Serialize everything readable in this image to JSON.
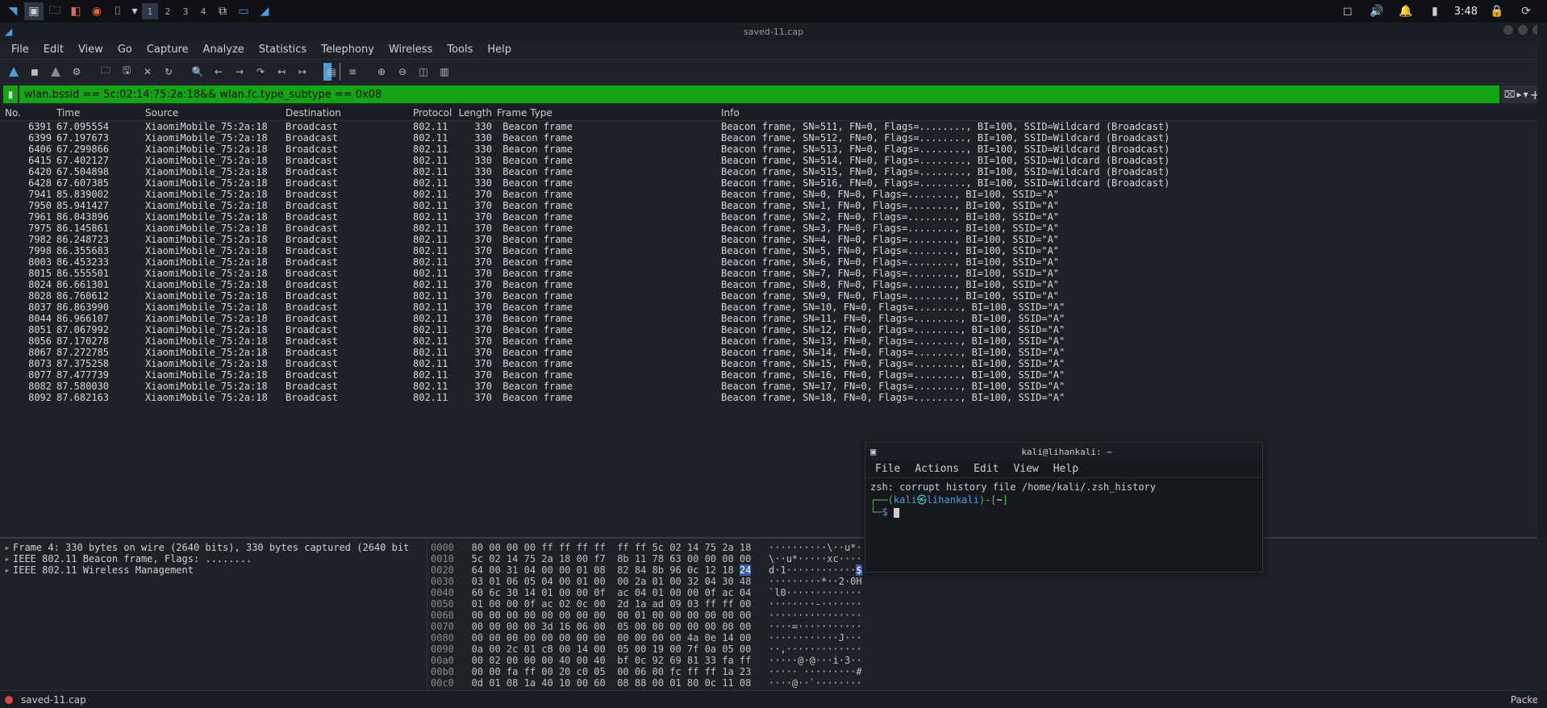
{
  "taskbar": {
    "workspaces": [
      "1",
      "2",
      "3",
      "4"
    ],
    "clock": "3:48"
  },
  "app": {
    "title": "saved-11.cap",
    "menus": [
      "File",
      "Edit",
      "View",
      "Go",
      "Capture",
      "Analyze",
      "Statistics",
      "Telephony",
      "Wireless",
      "Tools",
      "Help"
    ],
    "filter": "wlan.bssid == 5c:02:14:75:2a:18&& wlan.fc.type_subtype == 0x08",
    "columns": [
      "No.",
      "Time",
      "Source",
      "Destination",
      "Protocol",
      "Length",
      "Frame Type",
      "Info"
    ],
    "packets": [
      {
        "no": "6391",
        "time": "67.095554",
        "src": "XiaomiMobile_75:2a:18",
        "dst": "Broadcast",
        "proto": "802.11",
        "len": "330",
        "ftype": "Beacon frame",
        "info": "Beacon frame, SN=511, FN=0, Flags=........, BI=100, SSID=Wildcard (Broadcast)"
      },
      {
        "no": "6399",
        "time": "67.197673",
        "src": "XiaomiMobile_75:2a:18",
        "dst": "Broadcast",
        "proto": "802.11",
        "len": "330",
        "ftype": "Beacon frame",
        "info": "Beacon frame, SN=512, FN=0, Flags=........, BI=100, SSID=Wildcard (Broadcast)"
      },
      {
        "no": "6406",
        "time": "67.299866",
        "src": "XiaomiMobile_75:2a:18",
        "dst": "Broadcast",
        "proto": "802.11",
        "len": "330",
        "ftype": "Beacon frame",
        "info": "Beacon frame, SN=513, FN=0, Flags=........, BI=100, SSID=Wildcard (Broadcast)"
      },
      {
        "no": "6415",
        "time": "67.402127",
        "src": "XiaomiMobile_75:2a:18",
        "dst": "Broadcast",
        "proto": "802.11",
        "len": "330",
        "ftype": "Beacon frame",
        "info": "Beacon frame, SN=514, FN=0, Flags=........, BI=100, SSID=Wildcard (Broadcast)"
      },
      {
        "no": "6420",
        "time": "67.504898",
        "src": "XiaomiMobile_75:2a:18",
        "dst": "Broadcast",
        "proto": "802.11",
        "len": "330",
        "ftype": "Beacon frame",
        "info": "Beacon frame, SN=515, FN=0, Flags=........, BI=100, SSID=Wildcard (Broadcast)"
      },
      {
        "no": "6428",
        "time": "67.607385",
        "src": "XiaomiMobile_75:2a:18",
        "dst": "Broadcast",
        "proto": "802.11",
        "len": "330",
        "ftype": "Beacon frame",
        "info": "Beacon frame, SN=516, FN=0, Flags=........, BI=100, SSID=Wildcard (Broadcast)"
      },
      {
        "no": "7941",
        "time": "85.839002",
        "src": "XiaomiMobile_75:2a:18",
        "dst": "Broadcast",
        "proto": "802.11",
        "len": "370",
        "ftype": "Beacon frame",
        "info": "Beacon frame, SN=0, FN=0, Flags=........, BI=100, SSID=\"A\""
      },
      {
        "no": "7950",
        "time": "85.941427",
        "src": "XiaomiMobile_75:2a:18",
        "dst": "Broadcast",
        "proto": "802.11",
        "len": "370",
        "ftype": "Beacon frame",
        "info": "Beacon frame, SN=1, FN=0, Flags=........, BI=100, SSID=\"A\""
      },
      {
        "no": "7961",
        "time": "86.043896",
        "src": "XiaomiMobile_75:2a:18",
        "dst": "Broadcast",
        "proto": "802.11",
        "len": "370",
        "ftype": "Beacon frame",
        "info": "Beacon frame, SN=2, FN=0, Flags=........, BI=100, SSID=\"A\""
      },
      {
        "no": "7975",
        "time": "86.145861",
        "src": "XiaomiMobile_75:2a:18",
        "dst": "Broadcast",
        "proto": "802.11",
        "len": "370",
        "ftype": "Beacon frame",
        "info": "Beacon frame, SN=3, FN=0, Flags=........, BI=100, SSID=\"A\""
      },
      {
        "no": "7982",
        "time": "86.248723",
        "src": "XiaomiMobile_75:2a:18",
        "dst": "Broadcast",
        "proto": "802.11",
        "len": "370",
        "ftype": "Beacon frame",
        "info": "Beacon frame, SN=4, FN=0, Flags=........, BI=100, SSID=\"A\""
      },
      {
        "no": "7998",
        "time": "86.355683",
        "src": "XiaomiMobile_75:2a:18",
        "dst": "Broadcast",
        "proto": "802.11",
        "len": "370",
        "ftype": "Beacon frame",
        "info": "Beacon frame, SN=5, FN=0, Flags=........, BI=100, SSID=\"A\""
      },
      {
        "no": "8003",
        "time": "86.453233",
        "src": "XiaomiMobile_75:2a:18",
        "dst": "Broadcast",
        "proto": "802.11",
        "len": "370",
        "ftype": "Beacon frame",
        "info": "Beacon frame, SN=6, FN=0, Flags=........, BI=100, SSID=\"A\""
      },
      {
        "no": "8015",
        "time": "86.555501",
        "src": "XiaomiMobile_75:2a:18",
        "dst": "Broadcast",
        "proto": "802.11",
        "len": "370",
        "ftype": "Beacon frame",
        "info": "Beacon frame, SN=7, FN=0, Flags=........, BI=100, SSID=\"A\""
      },
      {
        "no": "8024",
        "time": "86.661301",
        "src": "XiaomiMobile_75:2a:18",
        "dst": "Broadcast",
        "proto": "802.11",
        "len": "370",
        "ftype": "Beacon frame",
        "info": "Beacon frame, SN=8, FN=0, Flags=........, BI=100, SSID=\"A\""
      },
      {
        "no": "8028",
        "time": "86.760612",
        "src": "XiaomiMobile_75:2a:18",
        "dst": "Broadcast",
        "proto": "802.11",
        "len": "370",
        "ftype": "Beacon frame",
        "info": "Beacon frame, SN=9, FN=0, Flags=........, BI=100, SSID=\"A\""
      },
      {
        "no": "8037",
        "time": "86.863990",
        "src": "XiaomiMobile_75:2a:18",
        "dst": "Broadcast",
        "proto": "802.11",
        "len": "370",
        "ftype": "Beacon frame",
        "info": "Beacon frame, SN=10, FN=0, Flags=........, BI=100, SSID=\"A\""
      },
      {
        "no": "8044",
        "time": "86.966107",
        "src": "XiaomiMobile_75:2a:18",
        "dst": "Broadcast",
        "proto": "802.11",
        "len": "370",
        "ftype": "Beacon frame",
        "info": "Beacon frame, SN=11, FN=0, Flags=........, BI=100, SSID=\"A\""
      },
      {
        "no": "8051",
        "time": "87.067992",
        "src": "XiaomiMobile_75:2a:18",
        "dst": "Broadcast",
        "proto": "802.11",
        "len": "370",
        "ftype": "Beacon frame",
        "info": "Beacon frame, SN=12, FN=0, Flags=........, BI=100, SSID=\"A\""
      },
      {
        "no": "8056",
        "time": "87.170278",
        "src": "XiaomiMobile_75:2a:18",
        "dst": "Broadcast",
        "proto": "802.11",
        "len": "370",
        "ftype": "Beacon frame",
        "info": "Beacon frame, SN=13, FN=0, Flags=........, BI=100, SSID=\"A\""
      },
      {
        "no": "8067",
        "time": "87.272785",
        "src": "XiaomiMobile_75:2a:18",
        "dst": "Broadcast",
        "proto": "802.11",
        "len": "370",
        "ftype": "Beacon frame",
        "info": "Beacon frame, SN=14, FN=0, Flags=........, BI=100, SSID=\"A\""
      },
      {
        "no": "8073",
        "time": "87.375258",
        "src": "XiaomiMobile_75:2a:18",
        "dst": "Broadcast",
        "proto": "802.11",
        "len": "370",
        "ftype": "Beacon frame",
        "info": "Beacon frame, SN=15, FN=0, Flags=........, BI=100, SSID=\"A\""
      },
      {
        "no": "8077",
        "time": "87.477739",
        "src": "XiaomiMobile_75:2a:18",
        "dst": "Broadcast",
        "proto": "802.11",
        "len": "370",
        "ftype": "Beacon frame",
        "info": "Beacon frame, SN=16, FN=0, Flags=........, BI=100, SSID=\"A\""
      },
      {
        "no": "8082",
        "time": "87.580030",
        "src": "XiaomiMobile_75:2a:18",
        "dst": "Broadcast",
        "proto": "802.11",
        "len": "370",
        "ftype": "Beacon frame",
        "info": "Beacon frame, SN=17, FN=0, Flags=........, BI=100, SSID=\"A\""
      },
      {
        "no": "8092",
        "time": "87.682163",
        "src": "XiaomiMobile 75:2a:18",
        "dst": "Broadcast",
        "proto": "802.11",
        "len": "370",
        "ftype": "Beacon frame",
        "info": "Beacon frame, SN=18, FN=0, Flags=........, BI=100, SSID=\"A\""
      }
    ],
    "tree": [
      "Frame 4: 330 bytes on wire (2640 bits), 330 bytes captured (2640 bit",
      "IEEE 802.11 Beacon frame, Flags: ........",
      "IEEE 802.11 Wireless Management"
    ],
    "hex": [
      {
        "off": "0000",
        "b": "80 00 00 00 ff ff ff ff  ff ff 5c 02 14 75 2a 18",
        "a": "··········\\··u*·"
      },
      {
        "off": "0010",
        "b": "5c 02 14 75 2a 18 00 f7  8b 11 78 63 00 00 00 00",
        "a": "\\··u*·····xc····"
      },
      {
        "off": "0020",
        "b": "64 00 31 04 00 00 01 08  82 84 8b 96 0c 12 18 24",
        "a": "d·1············$"
      },
      {
        "off": "0030",
        "b": "03 01 06 05 04 00 01 00  00 2a 01 00 32 04 30 48",
        "a": "·········*··2·0H"
      },
      {
        "off": "0040",
        "b": "60 6c 30 14 01 00 00 0f  ac 04 01 00 00 0f ac 04",
        "a": "`l0·············"
      },
      {
        "off": "0050",
        "b": "01 00 00 0f ac 02 0c 00  2d 1a ad 09 03 ff ff 00",
        "a": "········-·······"
      },
      {
        "off": "0060",
        "b": "00 00 00 00 00 00 00 00  00 01 00 00 00 00 00 00",
        "a": "················"
      },
      {
        "off": "0070",
        "b": "00 00 00 00 3d 16 06 00  05 00 00 00 00 00 00 00",
        "a": "····=···········"
      },
      {
        "off": "0080",
        "b": "00 00 00 00 00 00 00 00  00 00 00 00 4a 0e 14 00",
        "a": "············J···"
      },
      {
        "off": "0090",
        "b": "0a 00 2c 01 c8 00 14 00  05 00 19 00 7f 0a 05 00",
        "a": "··,·············"
      },
      {
        "off": "00a0",
        "b": "00 02 00 00 00 40 00 40  bf 0c 92 69 81 33 fa ff",
        "a": "·····@·@···i·3··"
      },
      {
        "off": "00b0",
        "b": "00 00 fa ff 00 20 c0 05  00 06 00 fc ff ff 1a 23",
        "a": "····· ·········#"
      },
      {
        "off": "00c0",
        "b": "0d 01 08 1a 40 10 00 60  08 88 00 01 80 0c 11 08",
        "a": "····@··`········"
      }
    ],
    "hex_highlight": {
      "row": 2,
      "col": 15,
      "byte": "24",
      "ascii_col": 15
    },
    "status_left": "saved-11.cap",
    "status_right": "Packet"
  },
  "terminal": {
    "title": "kali@lihankali: ~",
    "menus": [
      "File",
      "Actions",
      "Edit",
      "View",
      "Help"
    ],
    "line1": "zsh: corrupt history file /home/kali/.zsh_history",
    "prompt_user": "kali",
    "prompt_host": "lihankali",
    "prompt_path": "~"
  }
}
